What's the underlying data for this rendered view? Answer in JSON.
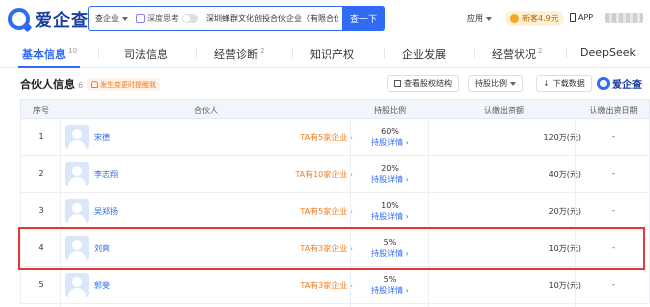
{
  "header": {
    "logo_text": "爱企查",
    "search_scope": "查企业",
    "deep_think_label": "深度思考",
    "search_value": "深圳蜂群文化创投合伙企业（有限合伙）",
    "search_button": "查一下",
    "app_menu": "应用",
    "vip_label": "新客4.9元",
    "app_download": "APP"
  },
  "tabs": [
    {
      "label": "基本信息",
      "count": "10"
    },
    {
      "label": "司法信息",
      "count": ""
    },
    {
      "label": "经营诊断",
      "count": "2"
    },
    {
      "label": "知识产权",
      "count": ""
    },
    {
      "label": "企业发展",
      "count": ""
    },
    {
      "label": "经营状况",
      "count": "2"
    },
    {
      "label": "DeepSeek",
      "count": ""
    }
  ],
  "section": {
    "title": "合伙人信息",
    "count": "6",
    "tip": "发生变更时提醒我",
    "btn_structure": "查看股权结构",
    "btn_sort": "持股比例",
    "btn_download": "下载数据",
    "brand": "爱企查"
  },
  "table": {
    "headers": [
      "序号",
      "合伙人",
      "持股比例",
      "认缴出资额",
      "认缴出资日期"
    ],
    "detail_label": "持股详情",
    "rows": [
      {
        "idx": "1",
        "name": "宋德",
        "link": "TA有5家企业",
        "ratio": "60%",
        "paid": "120万(元)",
        "date": "-"
      },
      {
        "idx": "2",
        "name": "李志翔",
        "link": "TA有10家企业",
        "ratio": "20%",
        "paid": "40万(元)",
        "date": "-"
      },
      {
        "idx": "3",
        "name": "吴郑扬",
        "link": "TA有5家企业",
        "ratio": "10%",
        "paid": "20万(元)",
        "date": "-"
      },
      {
        "idx": "4",
        "name": "刘爽",
        "link": "TA有3家企业",
        "ratio": "5%",
        "paid": "10万(元)",
        "date": "-"
      },
      {
        "idx": "5",
        "name": "郭斐",
        "link": "TA有3家企业",
        "ratio": "5%",
        "paid": "10万(元)",
        "date": "-"
      }
    ]
  },
  "colors": {
    "accent": "#2f6bf5",
    "link_orange": "#f07a1e",
    "highlight_red": "#e53935"
  }
}
